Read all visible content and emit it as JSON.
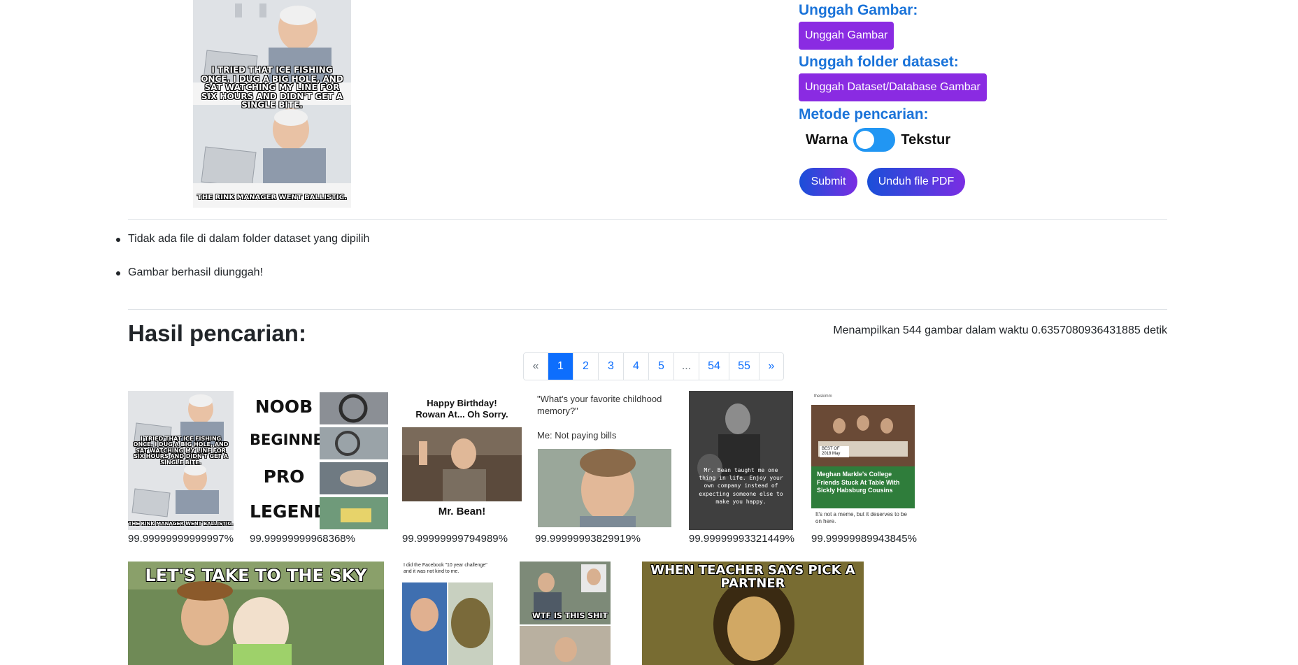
{
  "query_image": {
    "caption_top": "I TRIED THAT ICE FISHING ONCE. I DUG A BIG HOLE, AND SAT WATCHING MY LINE FOR SIX HOURS AND DIDN'T GET A SINGLE BITE.",
    "caption_bottom": "THE RINK MANAGER WENT BALLISTIC."
  },
  "controls": {
    "upload_image_heading": "Unggah Gambar:",
    "upload_image_button": "Unggah Gambar",
    "upload_folder_heading": "Unggah folder dataset:",
    "upload_folder_button": "Unggah Dataset/Database Gambar",
    "method_heading": "Metode pencarian:",
    "toggle_left": "Warna",
    "toggle_right": "Tekstur",
    "toggle_state": "Warna",
    "submit_button": "Submit",
    "pdf_button": "Unduh file PDF"
  },
  "messages": [
    "Tidak ada file di dalam folder dataset yang dipilih",
    "Gambar berhasil diunggah!"
  ],
  "results": {
    "title": "Hasil pencarian:",
    "info": "Menampilkan 544 gambar dalam waktu 0.6357080936431885 detik",
    "pagination": [
      "«",
      "1",
      "2",
      "3",
      "4",
      "5",
      "...",
      "54",
      "55",
      "»"
    ],
    "active_page": "1",
    "items": [
      {
        "score": "99.99999999999997%",
        "caption_top": "I TRIED THAT ICE FISHING ONCE. I DUG A BIG HOLE, AND SAT WATCHING MY LINE FOR SIX HOURS AND DIDN'T GET A SINGLE BITE.",
        "caption_bottom": "THE RINK MANAGER WENT BALLISTIC."
      },
      {
        "score": "99.99999999968368%",
        "words": [
          "NOOB",
          "BEGINNER",
          "PRO",
          "LEGEND"
        ]
      },
      {
        "score": "99.99999999794989%",
        "top_text": "Happy Birthday! Rowan At... Oh Sorry.",
        "bottom_text": "Mr. Bean!"
      },
      {
        "score": "99.99999993829919%",
        "line1": "\"What's your favorite childhood memory?\"",
        "line2": "Me: Not paying bills"
      },
      {
        "score": "99.99999993321449%",
        "text": "Mr. Bean taught me one thing in life. Enjoy your own company instead of expecting someone else to make you happy."
      },
      {
        "score": "99.99999989943845%",
        "source": "theskimm",
        "badge": "BEST OF 2018 May",
        "headline": "Meghan Markle's College Friends Stuck At Table With Sickly Habsburg Cousins",
        "footer": "It's not a meme, but it deserves to be on here."
      },
      {
        "caption": "LET'S TAKE TO THE SKY"
      },
      {
        "caption": "I did the Facebook \"10 year challenge\" and it was not kind to me."
      },
      {
        "caption": "WTF IS THIS SHIT"
      },
      {
        "caption": "WHEN TEACHER SAYS PICK A PARTNER"
      }
    ]
  },
  "colors": {
    "accent_blue": "#1a73d9",
    "purple": "#8a2be2",
    "toggle_blue": "#2196f3",
    "page_active": "#0d6efd"
  }
}
